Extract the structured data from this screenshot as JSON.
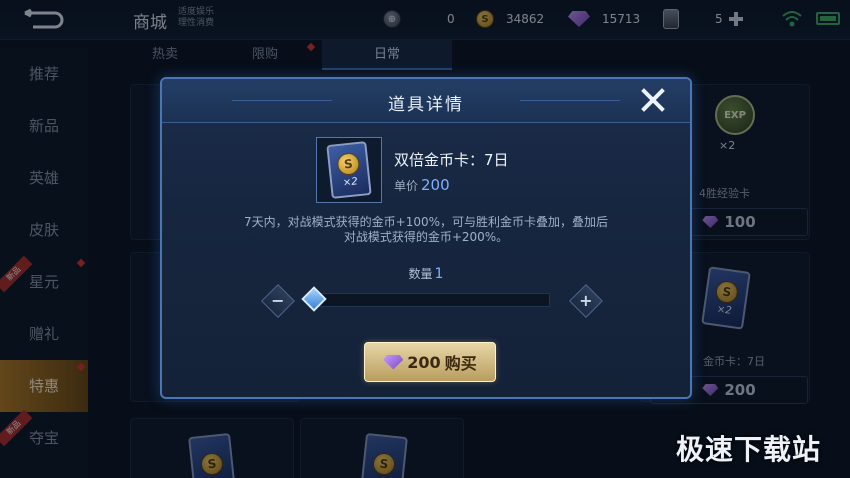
{
  "header": {
    "title": "商城",
    "subtitle_line1": "适度娱乐",
    "subtitle_line2": "理性消费",
    "currencies": [
      {
        "icon": "coupon-icon",
        "glyph": "⊕",
        "value": "0"
      },
      {
        "icon": "gold-coin-icon",
        "glyph": "S",
        "value": "34862"
      },
      {
        "icon": "diamond-icon",
        "value": "15713"
      },
      {
        "icon": "card-icon",
        "value": "5"
      }
    ]
  },
  "tabs": [
    {
      "label": "热卖"
    },
    {
      "label": "限购"
    },
    {
      "label": "日常"
    }
  ],
  "sidebar": {
    "items": [
      {
        "label": "推荐"
      },
      {
        "label": "新品"
      },
      {
        "label": "英雄"
      },
      {
        "label": "皮肤"
      },
      {
        "label": "星元"
      },
      {
        "label": "赠礼"
      },
      {
        "label": "特惠"
      },
      {
        "label": "夺宝"
      }
    ],
    "badge": "新品"
  },
  "background": {
    "exp_text": "EXP",
    "x2_text": "×2",
    "exp_card_label": "4胜经验卡",
    "exp_card_price": "100",
    "gold_card_label": "金币卡：7日",
    "gold_card_price": "200",
    "coin_glyph": "S"
  },
  "dialog": {
    "title": "道具详情",
    "item_name": "双倍金币卡：7日",
    "unit_price_label": "单价",
    "unit_price": "200",
    "x2_text": "×2",
    "desc_line1": "7天内，对战模式获得的金币+100%，可与胜利金币卡叠加，叠加后",
    "desc_line2": "对战模式获得的金币+200%。",
    "qty_label": "数量",
    "qty_value": "1",
    "minus": "−",
    "plus": "+",
    "buy_amount": "200",
    "buy_label": "购买"
  },
  "watermark": "极速下载站",
  "colors": {
    "accent_blue": "#7fb0ff",
    "gold": "#b89d5e",
    "active_side": "#b57d28"
  }
}
